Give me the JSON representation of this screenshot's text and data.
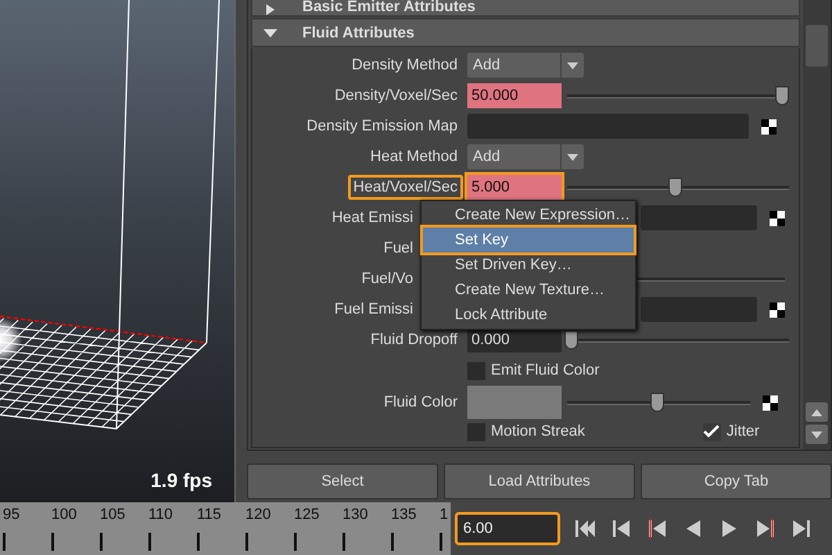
{
  "viewport": {
    "fps": "1.9 fps"
  },
  "sections": [
    {
      "title": "Basic Emitter Attributes",
      "expanded": false
    },
    {
      "title": "Fluid Attributes",
      "expanded": true
    }
  ],
  "attributes": [
    {
      "kind": "dropdown",
      "label": "Density Method",
      "value": "Add"
    },
    {
      "kind": "slider",
      "label": "Density/Voxel/Sec",
      "value": "50.000",
      "keyed": true,
      "highlighted": false,
      "level": 0.97
    },
    {
      "kind": "map",
      "label": "Density Emission Map"
    },
    {
      "kind": "dropdown",
      "label": "Heat Method",
      "value": "Add"
    },
    {
      "kind": "slider",
      "label": "Heat/Voxel/Sec",
      "value": "5.000",
      "keyed": true,
      "highlighted": true,
      "level": 0.49
    },
    {
      "kind": "map",
      "label": "Heat Emissi",
      "covered": true
    },
    {
      "kind": "dropdown",
      "label": "Fuel",
      "covered": true
    },
    {
      "kind": "slider",
      "label": "Fuel/Vo",
      "covered": true
    },
    {
      "kind": "map",
      "label": "Fuel Emissi",
      "covered": true
    },
    {
      "kind": "slider",
      "label": "Fluid Dropoff",
      "value": "0.000",
      "keyed": false,
      "highlighted": false,
      "level": 0.02
    },
    {
      "kind": "checkbox",
      "label": "Emit Fluid Color",
      "checked": false
    },
    {
      "kind": "color",
      "label": "Fluid Color",
      "level": 0.49
    },
    {
      "kind": "checkpair",
      "items": [
        {
          "label": "Motion Streak",
          "checked": false
        },
        {
          "label": "Jitter",
          "checked": true
        }
      ]
    }
  ],
  "context_menu": [
    {
      "label": "Create New Expression…",
      "selected": false
    },
    {
      "label": "Set Key",
      "selected": true
    },
    {
      "label": "Set Driven Key…",
      "selected": false
    },
    {
      "label": "Create New Texture…",
      "selected": false
    },
    {
      "label": "Lock Attribute",
      "selected": false
    }
  ],
  "buttons": [
    "Select",
    "Load Attributes",
    "Copy Tab"
  ],
  "timeline": {
    "ticks": [
      "95",
      "100",
      "105",
      "110",
      "115",
      "120",
      "125",
      "130",
      "135",
      "1"
    ],
    "current_frame": "6.00"
  }
}
